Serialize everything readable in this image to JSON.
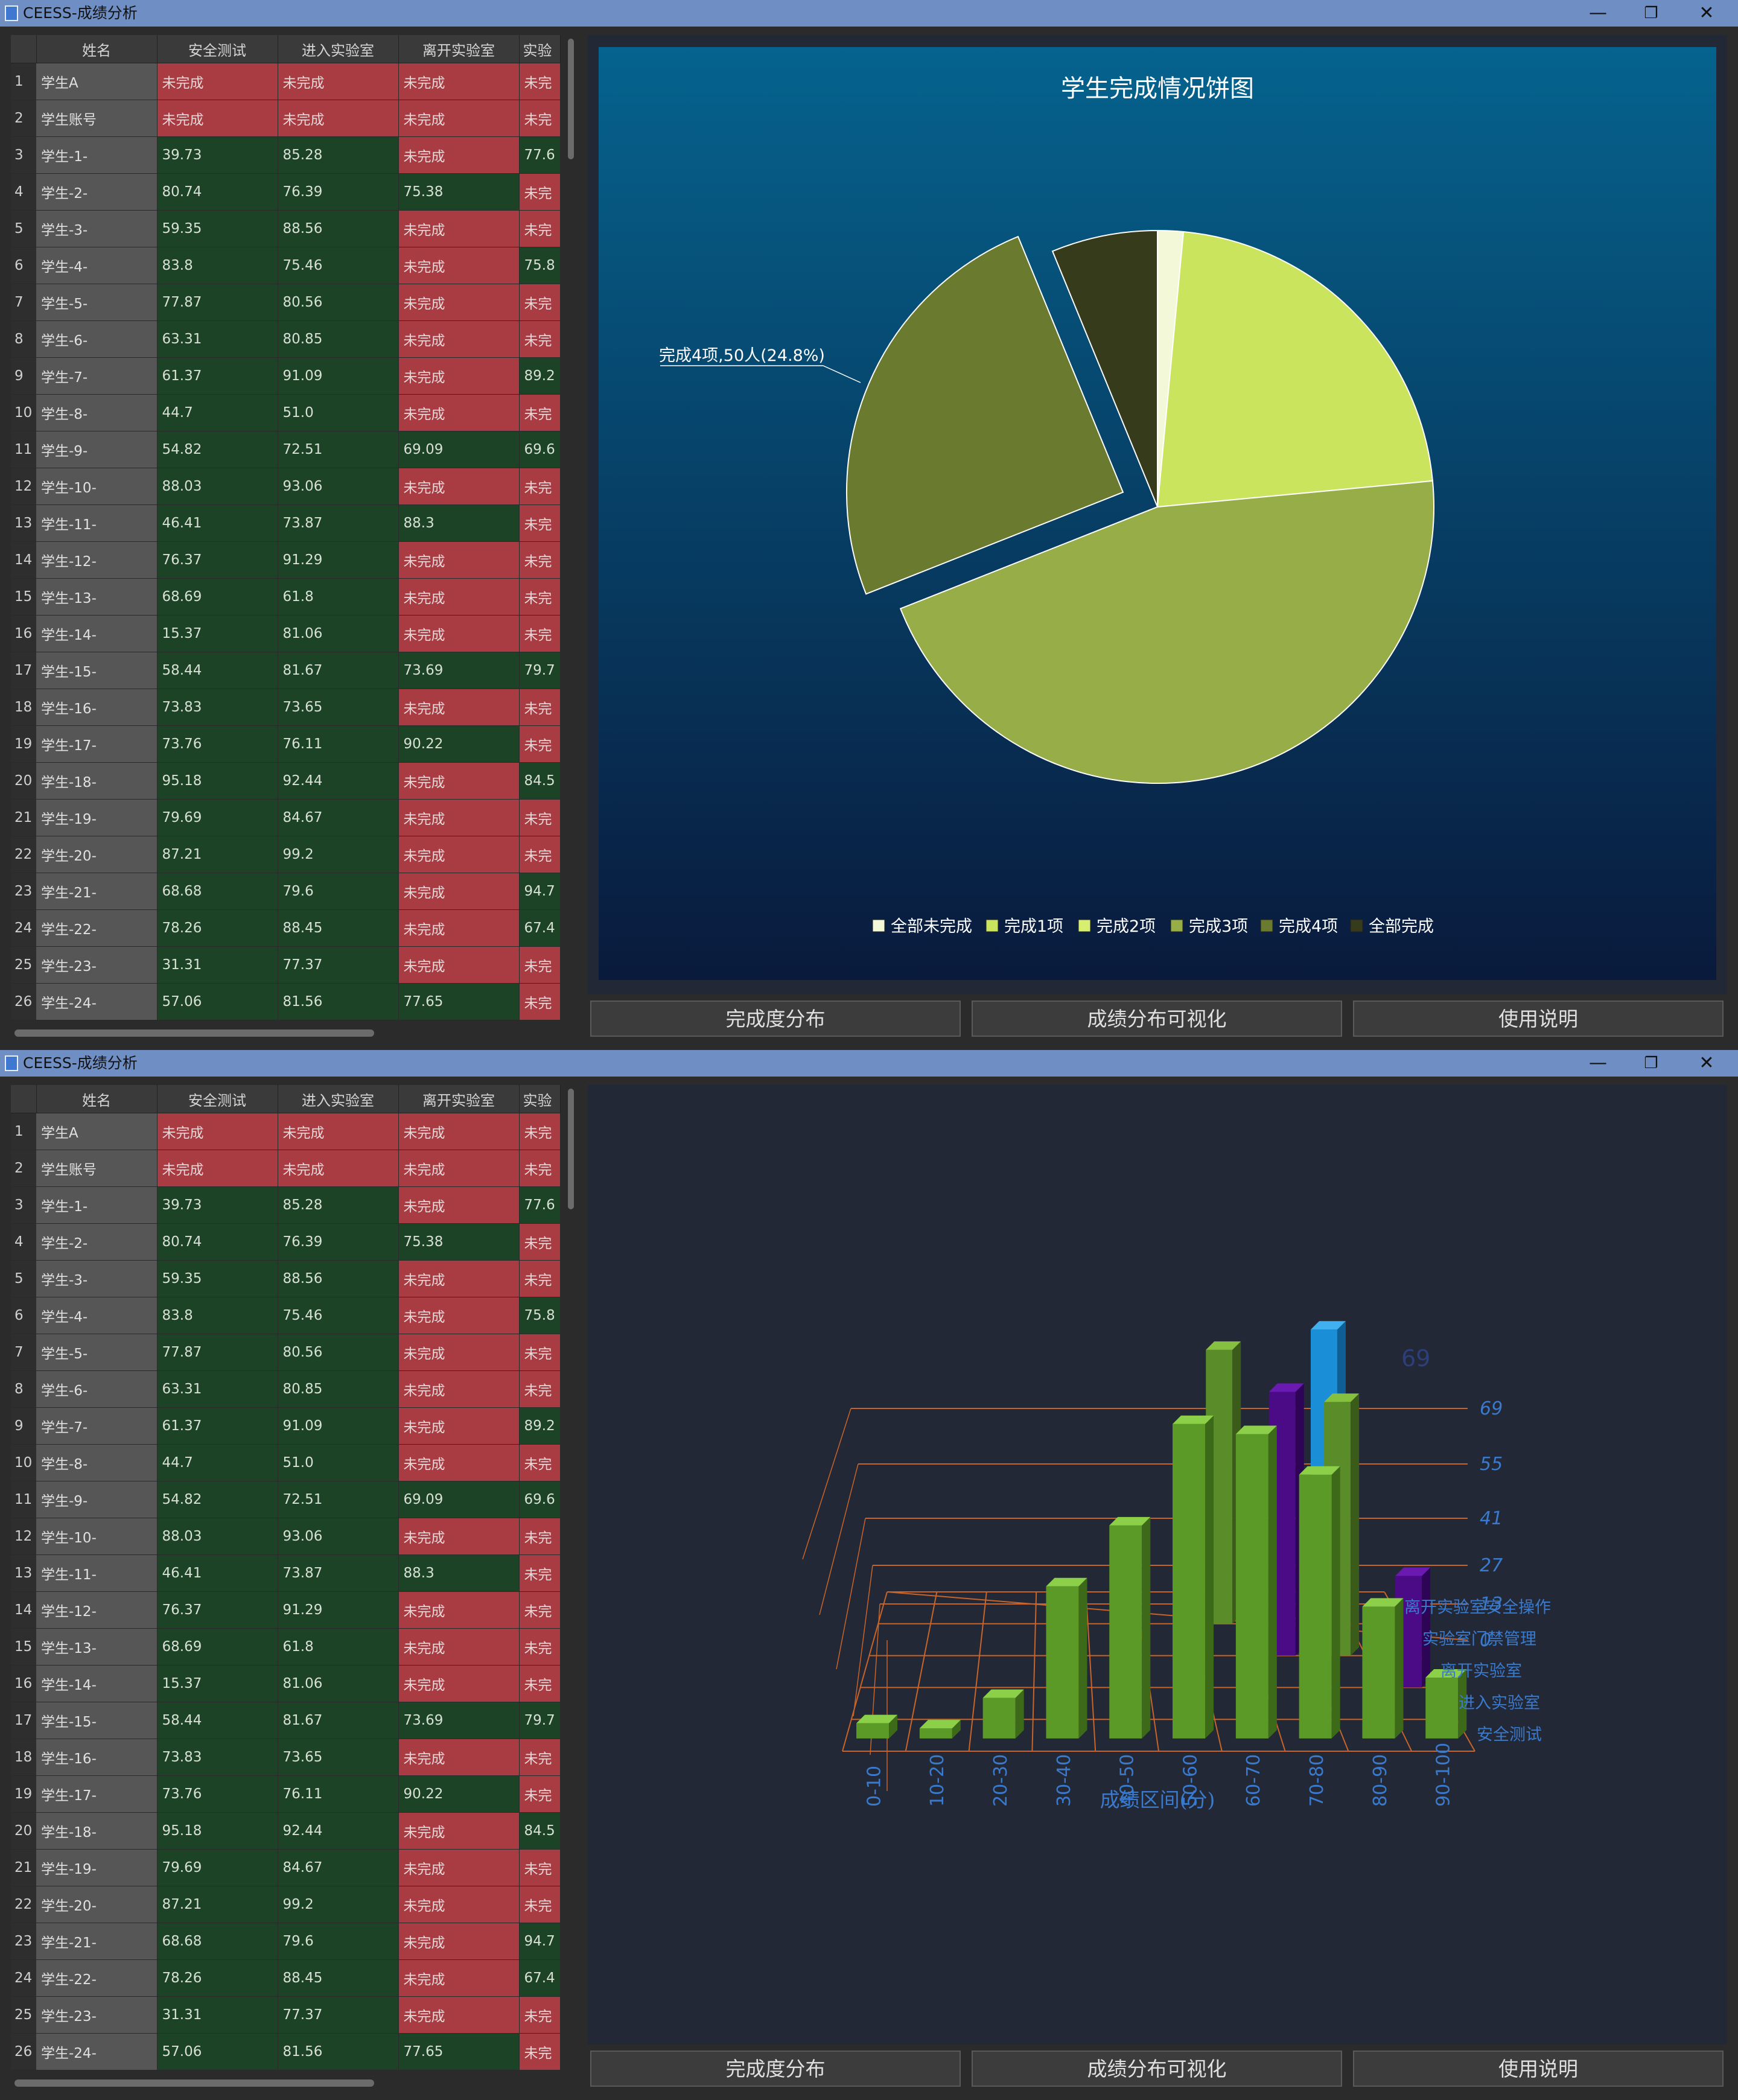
{
  "window": {
    "title": "CEESS-成绩分析",
    "min_icon": "minimize-icon",
    "max_icon": "restore-icon",
    "close_icon": "close-icon"
  },
  "table": {
    "headers": [
      "姓名",
      "安全测试",
      "进入实验室",
      "离开实验室",
      "实验"
    ],
    "rows": [
      {
        "idx": "1",
        "name": "学生A",
        "c1": "未完成",
        "c2": "未完成",
        "c3": "未完成",
        "c4": "未完"
      },
      {
        "idx": "2",
        "name": "学生账号",
        "c1": "未完成",
        "c2": "未完成",
        "c3": "未完成",
        "c4": "未完"
      },
      {
        "idx": "3",
        "name": "学生-1-",
        "c1": "39.73",
        "c2": "85.28",
        "c3": "未完成",
        "c4": "77.6"
      },
      {
        "idx": "4",
        "name": "学生-2-",
        "c1": "80.74",
        "c2": "76.39",
        "c3": "75.38",
        "c4": "未完"
      },
      {
        "idx": "5",
        "name": "学生-3-",
        "c1": "59.35",
        "c2": "88.56",
        "c3": "未完成",
        "c4": "未完"
      },
      {
        "idx": "6",
        "name": "学生-4-",
        "c1": "83.8",
        "c2": "75.46",
        "c3": "未完成",
        "c4": "75.8"
      },
      {
        "idx": "7",
        "name": "学生-5-",
        "c1": "77.87",
        "c2": "80.56",
        "c3": "未完成",
        "c4": "未完"
      },
      {
        "idx": "8",
        "name": "学生-6-",
        "c1": "63.31",
        "c2": "80.85",
        "c3": "未完成",
        "c4": "未完"
      },
      {
        "idx": "9",
        "name": "学生-7-",
        "c1": "61.37",
        "c2": "91.09",
        "c3": "未完成",
        "c4": "89.2"
      },
      {
        "idx": "10",
        "name": "学生-8-",
        "c1": "44.7",
        "c2": "51.0",
        "c3": "未完成",
        "c4": "未完"
      },
      {
        "idx": "11",
        "name": "学生-9-",
        "c1": "54.82",
        "c2": "72.51",
        "c3": "69.09",
        "c4": "69.6"
      },
      {
        "idx": "12",
        "name": "学生-10-",
        "c1": "88.03",
        "c2": "93.06",
        "c3": "未完成",
        "c4": "未完"
      },
      {
        "idx": "13",
        "name": "学生-11-",
        "c1": "46.41",
        "c2": "73.87",
        "c3": "88.3",
        "c4": "未完"
      },
      {
        "idx": "14",
        "name": "学生-12-",
        "c1": "76.37",
        "c2": "91.29",
        "c3": "未完成",
        "c4": "未完"
      },
      {
        "idx": "15",
        "name": "学生-13-",
        "c1": "68.69",
        "c2": "61.8",
        "c3": "未完成",
        "c4": "未完"
      },
      {
        "idx": "16",
        "name": "学生-14-",
        "c1": "15.37",
        "c2": "81.06",
        "c3": "未完成",
        "c4": "未完"
      },
      {
        "idx": "17",
        "name": "学生-15-",
        "c1": "58.44",
        "c2": "81.67",
        "c3": "73.69",
        "c4": "79.7"
      },
      {
        "idx": "18",
        "name": "学生-16-",
        "c1": "73.83",
        "c2": "73.65",
        "c3": "未完成",
        "c4": "未完"
      },
      {
        "idx": "19",
        "name": "学生-17-",
        "c1": "73.76",
        "c2": "76.11",
        "c3": "90.22",
        "c4": "未完"
      },
      {
        "idx": "20",
        "name": "学生-18-",
        "c1": "95.18",
        "c2": "92.44",
        "c3": "未完成",
        "c4": "84.5"
      },
      {
        "idx": "21",
        "name": "学生-19-",
        "c1": "79.69",
        "c2": "84.67",
        "c3": "未完成",
        "c4": "未完"
      },
      {
        "idx": "22",
        "name": "学生-20-",
        "c1": "87.21",
        "c2": "99.2",
        "c3": "未完成",
        "c4": "未完"
      },
      {
        "idx": "23",
        "name": "学生-21-",
        "c1": "68.68",
        "c2": "79.6",
        "c3": "未完成",
        "c4": "94.7"
      },
      {
        "idx": "24",
        "name": "学生-22-",
        "c1": "78.26",
        "c2": "88.45",
        "c3": "未完成",
        "c4": "67.4"
      },
      {
        "idx": "25",
        "name": "学生-23-",
        "c1": "31.31",
        "c2": "77.37",
        "c3": "未完成",
        "c4": "未完"
      },
      {
        "idx": "26",
        "name": "学生-24-",
        "c1": "57.06",
        "c2": "81.56",
        "c3": "77.65",
        "c4": "未完"
      }
    ]
  },
  "buttons": {
    "b1": "完成度分布",
    "b2": "成绩分布可视化",
    "b3": "使用说明"
  },
  "colors": {
    "incomplete_cell": "#a93b43",
    "complete_cell": "#1c4326",
    "accent_orange": "#c8642a",
    "axis_blue": "#3a7acd"
  },
  "chart_data": [
    {
      "type": "pie",
      "title": "学生完成情况饼图",
      "labels": [
        "全部未完成",
        "完成1项",
        "完成2项",
        "完成3项",
        "完成4项",
        "全部完成"
      ],
      "values": [
        1.5,
        22.0,
        0,
        45.5,
        24.8,
        6.2
      ],
      "colors": [
        "#f2f8d8",
        "#cbe45e",
        "#d6ef70",
        "#97ad47",
        "#6a7a2f",
        "#363c1b"
      ],
      "exploded": "完成4项",
      "annotation": "完成4项,50人(24.8%)",
      "legend_position": "bottom"
    },
    {
      "type": "bar",
      "mode": "3d",
      "xlabel": "成绩区间(分)",
      "categories": [
        "0-10",
        "10-20",
        "20-30",
        "30-40",
        "40-50",
        "50-60",
        "60-70",
        "70-80",
        "80-90",
        "90-100"
      ],
      "zticks": [
        "0",
        "13",
        "27",
        "41",
        "55",
        "69"
      ],
      "rows": [
        "安全测试",
        "进入实验室",
        "离开实验室",
        "实验室门禁管理",
        "离开实验室安全操作"
      ],
      "highlight_label": "69",
      "series_front": {
        "name": "安全测试",
        "values": [
          3,
          2,
          8,
          30,
          42,
          62,
          60,
          52,
          26,
          12
        ]
      }
    }
  ]
}
